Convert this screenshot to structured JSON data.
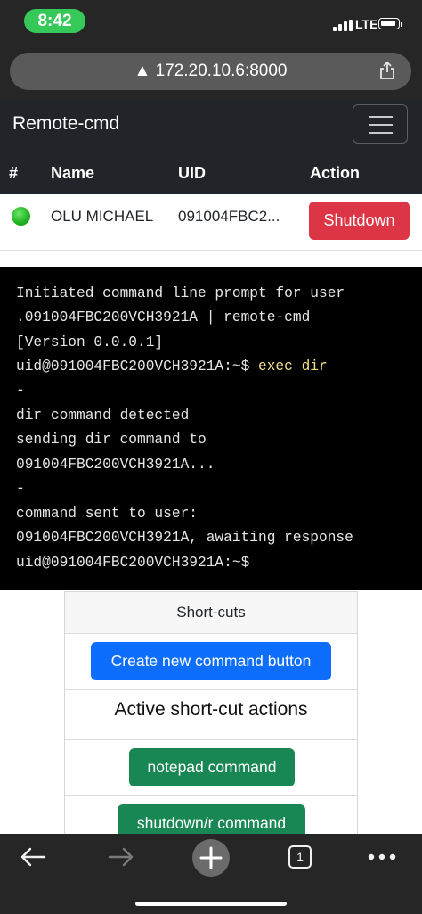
{
  "status_bar": {
    "time": "8:42",
    "network": "LTE",
    "time_pill_color": "#36c95a"
  },
  "browser": {
    "url": "▲ 172.20.10.6:8000",
    "icons": [
      "share-icon",
      "back-icon",
      "forward-icon",
      "new-tab-icon",
      "tabs-icon",
      "more-icon"
    ],
    "tab_count": "1"
  },
  "navbar": {
    "brand": "Remote-cmd",
    "menu_icon": "hamburger-icon"
  },
  "table": {
    "headers": [
      "#",
      "Name",
      "UID",
      "Action"
    ],
    "rows": [
      {
        "status_color": "#20b020",
        "name": "OLU MICHAEL",
        "uid": "091004FBC2...",
        "action": "Shutdown"
      }
    ]
  },
  "terminal": {
    "lines": [
      "Initiated command line prompt for user",
      ".091004FBC200VCH3921A | remote-cmd",
      "[Version 0.0.0.1]",
      "uid@091004FBC200VCH3921A:~$ ",
      "-",
      "dir command detected",
      "sending dir command to",
      "091004FBC200VCH3921A...",
      "-",
      "command sent to user:",
      "091004FBC200VCH3921A, awaiting response",
      "uid@091004FBC200VCH3921A:~$"
    ],
    "entered_command": "exec dir",
    "command_color": "#f2e089"
  },
  "shortcuts": {
    "header": "Short-cuts",
    "create_button": "Create new command button",
    "active_title": "Active short-cut actions",
    "actions": [
      "notepad command",
      "shutdown/r command"
    ]
  },
  "colors": {
    "navbar_bg": "#212529",
    "danger": "#dc3545",
    "primary": "#0d6efd",
    "success": "#198754"
  }
}
